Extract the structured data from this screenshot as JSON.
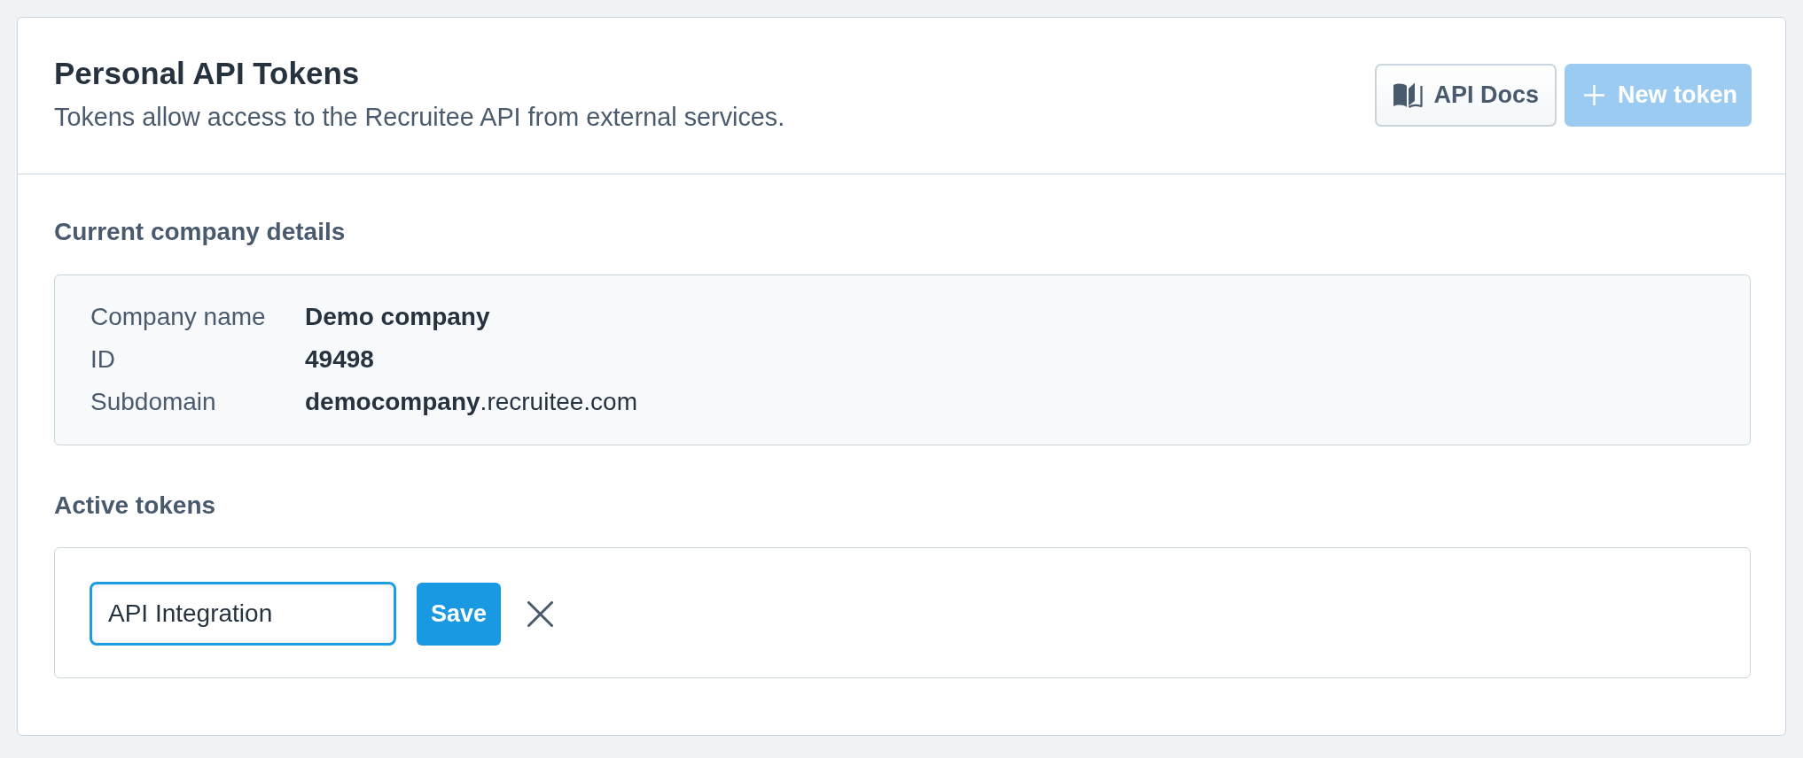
{
  "header": {
    "title": "Personal API Tokens",
    "subtitle": "Tokens allow access to the Recruitee API from external services.",
    "buttons": [
      {
        "kind": "docs",
        "label": "API Docs",
        "disabled": false
      },
      {
        "kind": "primary",
        "label": "New token",
        "disabled": true
      }
    ]
  },
  "company_details": {
    "heading": "Current company details",
    "rows": [
      {
        "label": "Company name",
        "value": "Demo company",
        "bold": true
      },
      {
        "label": "ID",
        "value": "49498",
        "bold": true
      },
      {
        "label": "Subdomain",
        "value": "**democompany**.recruitee.com",
        "bold": false
      }
    ]
  },
  "active_tokens": {
    "heading": "Active tokens",
    "name_field": {
      "value": "API Integration",
      "focused": true
    },
    "save_button": {
      "label": "Save"
    }
  }
}
